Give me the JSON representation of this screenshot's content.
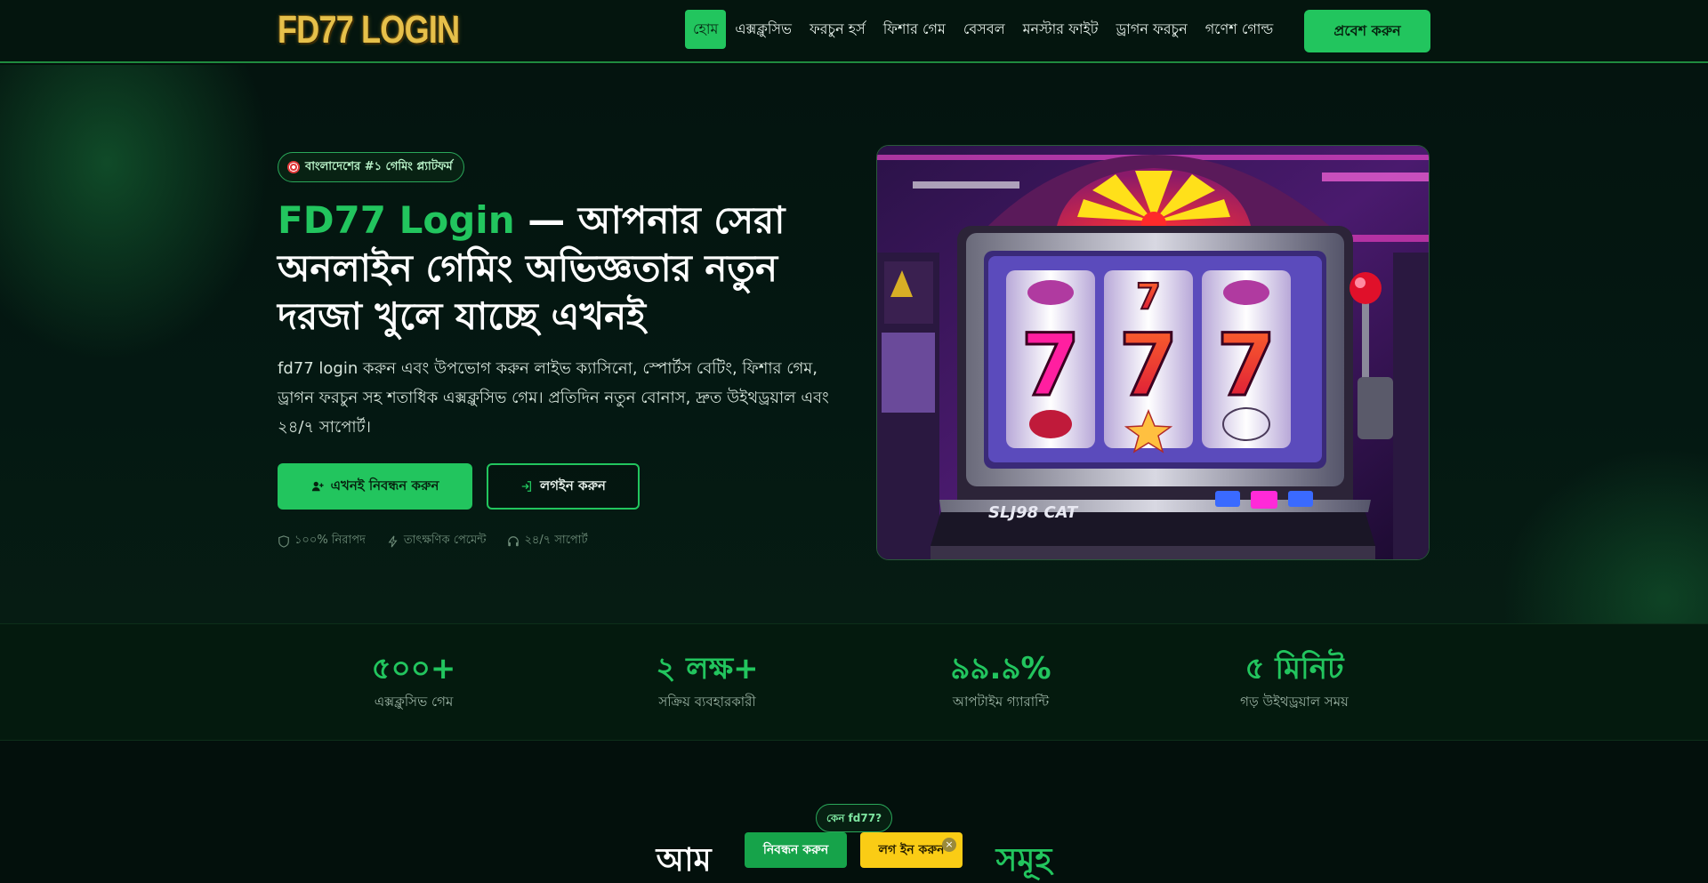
{
  "header": {
    "logo": "FD77 LOGIN",
    "nav": [
      {
        "label": "হোম",
        "active": true
      },
      {
        "label": "এক্সক্লুসিভ"
      },
      {
        "label": "ফরচুন হর্স"
      },
      {
        "label": "ফিশার গেম"
      },
      {
        "label": "বেসবল"
      },
      {
        "label": "মনস্টার ফাইট"
      },
      {
        "label": "ড্রাগন ফরচুন"
      },
      {
        "label": "গণেশ গোল্ড"
      }
    ],
    "enter_button": "প্রবেশ করুন"
  },
  "hero": {
    "badge": "বাংলাদেশের #১ গেমিং প্ল্যাটফর্ম",
    "title_accent": "FD77 Login",
    "title_rest": " — আপনার সেরা অনলাইন গেমিং অভিজ্ঞতার নতুন দরজা খুলে যাচ্ছে এখনই",
    "description": "fd77 login করুন এবং উপভোগ করুন লাইভ ক্যাসিনো, স্পোর্টস বেটিং, ফিশার গেম, ড্রাগন ফরচুন সহ শতাধিক এক্সক্লুসিভ গেম। প্রতিদিন নতুন বোনাস, দ্রুত উইথড্রয়াল এবং ২৪/৭ সাপোর্ট।",
    "primary_button": "এখনই নিবন্ধন করুন",
    "secondary_button": "লগইন করুন",
    "trust": [
      {
        "icon": "shield-icon",
        "label": "১০০% নিরাপদ"
      },
      {
        "icon": "lightning-icon",
        "label": "তাৎক্ষণিক পেমেন্ট"
      },
      {
        "icon": "headset-icon",
        "label": "২৪/৭ সাপোর্ট"
      }
    ],
    "image": {
      "machine_label": "SLJ98 CAT",
      "reel_symbol": "7"
    }
  },
  "stats": [
    {
      "value": "৫০০+",
      "label": "এক্সক্লুসিভ গেম"
    },
    {
      "value": "২ লক্ষ+",
      "label": "সক্রিয় ব্যবহারকারী"
    },
    {
      "value": "৯৯.৯%",
      "label": "আপটাইম গ্যারান্টি"
    },
    {
      "value": "৫ মিনিট",
      "label": "গড় উইথড্রয়াল সময়"
    }
  ],
  "why": {
    "badge": "কেন fd77?",
    "title_start": "আম",
    "title_accent": "সমূহ"
  },
  "floating": {
    "register": "নিবন্ধন করুন",
    "login": "লগ ইন করুন",
    "close": "×"
  },
  "colors": {
    "accent": "#22c55e",
    "gold": "#facc15",
    "background": "#03100c"
  }
}
